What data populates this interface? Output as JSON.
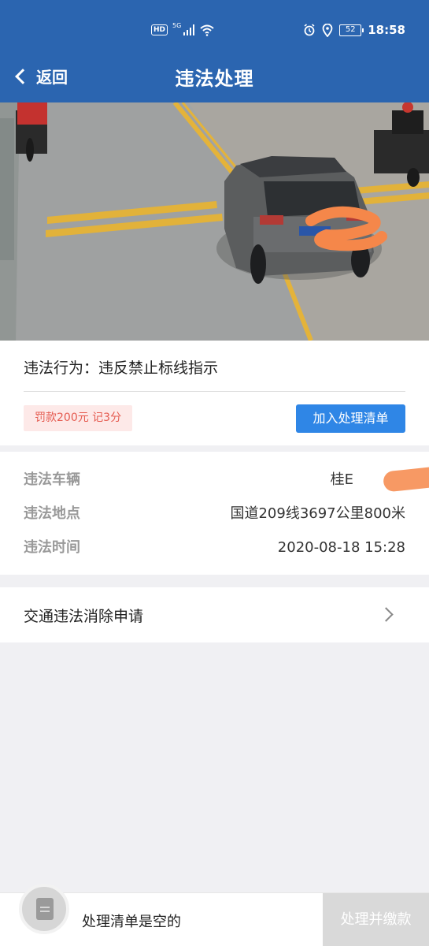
{
  "status_bar": {
    "hd": "HD",
    "network": "5G",
    "battery": "52",
    "time": "18:58"
  },
  "navbar": {
    "back_label": "返回",
    "title": "违法处理"
  },
  "violation": {
    "behavior": "违法行为：违反禁止标线指示",
    "penalty": "罚款200元 记3分",
    "add_button": "加入处理清单"
  },
  "details": {
    "vehicle_label": "违法车辆",
    "vehicle_value": "桂E",
    "location_label": "违法地点",
    "location_value": "国道209线3697公里800米",
    "time_label": "违法时间",
    "time_value": "2020-08-18  15:28"
  },
  "elimination": {
    "label": "交通违法消除申请"
  },
  "bottom_bar": {
    "empty_text": "处理清单是空的",
    "pay_button": "处理并缴款"
  },
  "colors": {
    "brand": "#2b65b0",
    "button": "#2f86e6",
    "penalty_text": "#e55b50",
    "penalty_bg": "#fde9e8"
  }
}
